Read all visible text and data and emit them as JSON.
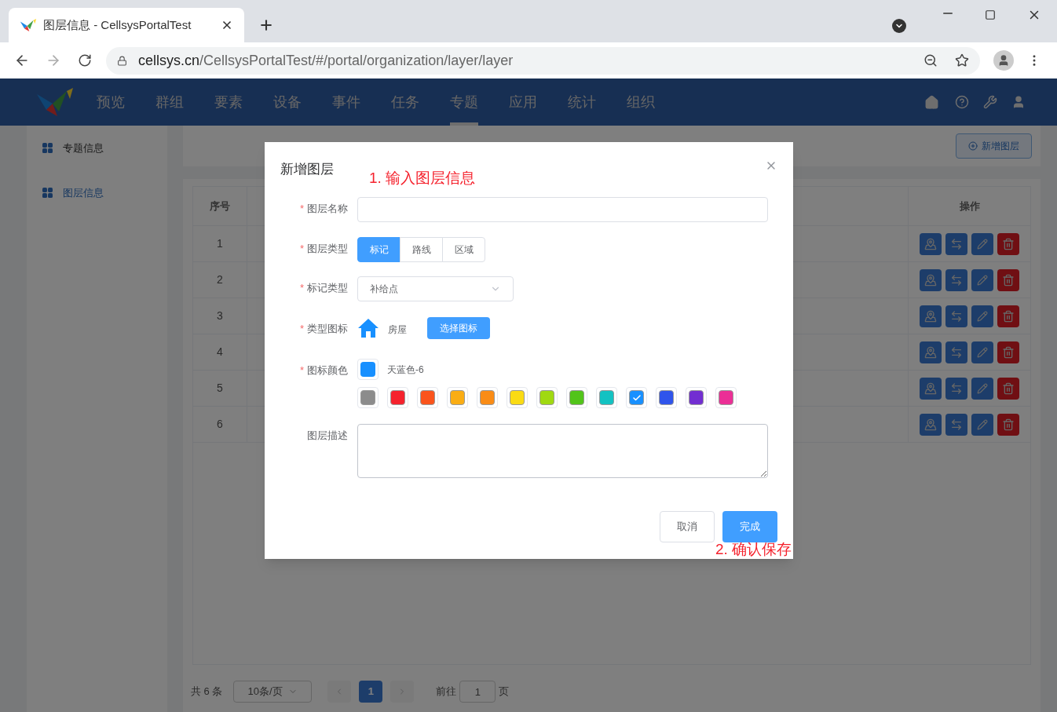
{
  "browser": {
    "tab_title": "图层信息 - CellsysPortalTest",
    "url_host": "cellsys.cn",
    "url_path": "/CellsysPortalTest/#/portal/organization/layer/layer"
  },
  "nav": {
    "items": [
      {
        "label": "预览",
        "selected": false
      },
      {
        "label": "群组",
        "selected": false
      },
      {
        "label": "要素",
        "selected": false
      },
      {
        "label": "设备",
        "selected": false
      },
      {
        "label": "事件",
        "selected": false
      },
      {
        "label": "任务",
        "selected": false
      },
      {
        "label": "专题",
        "selected": true
      },
      {
        "label": "应用",
        "selected": false
      },
      {
        "label": "统计",
        "selected": false
      },
      {
        "label": "组织",
        "selected": false
      }
    ]
  },
  "sidebar": {
    "items": [
      {
        "label": "专题信息",
        "selected": false
      },
      {
        "label": "图层信息",
        "selected": true
      }
    ]
  },
  "toolbar": {
    "add_button": "新增图层"
  },
  "table": {
    "columns": [
      "序号",
      "操作"
    ],
    "rows": [
      {
        "index": "1"
      },
      {
        "index": "2"
      },
      {
        "index": "3"
      },
      {
        "index": "4"
      },
      {
        "index": "5"
      },
      {
        "index": "6"
      }
    ]
  },
  "pagination": {
    "total": "共 6 条",
    "page_size": "10条/页",
    "pages": [
      {
        "label": "1",
        "selected": true
      }
    ],
    "goto_prefix": "前往",
    "goto_value": "1",
    "goto_suffix": "页"
  },
  "dialog": {
    "title": "新增图层",
    "note_top": "1. 输入图层信息",
    "note_bottom": "2. 确认保存",
    "fields": [
      {
        "kind": "text",
        "label": "图层名称",
        "required_mark": "*"
      },
      {
        "kind": "segmented",
        "label": "图层类型",
        "required_mark": "*",
        "options": [
          {
            "label": "标记",
            "selected": true
          },
          {
            "label": "路线",
            "selected": false
          },
          {
            "label": "区域",
            "selected": false
          }
        ]
      },
      {
        "kind": "select",
        "label": "标记类型",
        "required_mark": "*",
        "value": "补给点"
      },
      {
        "kind": "icon",
        "label": "类型图标",
        "required_mark": "*",
        "icon_name": "房屋",
        "button": "选择图标"
      },
      {
        "kind": "color",
        "label": "图标颜色",
        "required_mark": "*",
        "current": {
          "color": "#1890ff",
          "name": "天蓝色-6"
        },
        "swatches": [
          {
            "color": "#8c8c8c",
            "selected": false
          },
          {
            "color": "#f5222d",
            "selected": false
          },
          {
            "color": "#fa541c",
            "selected": false
          },
          {
            "color": "#faad14",
            "selected": false
          },
          {
            "color": "#fa8c16",
            "selected": false
          },
          {
            "color": "#fadb14",
            "selected": false
          },
          {
            "color": "#a0d911",
            "selected": false
          },
          {
            "color": "#52c41a",
            "selected": false
          },
          {
            "color": "#13c2c2",
            "selected": false
          },
          {
            "color": "#1890ff",
            "selected": true
          },
          {
            "color": "#2f54eb",
            "selected": false
          },
          {
            "color": "#722ed1",
            "selected": false
          },
          {
            "color": "#eb2f96",
            "selected": false
          }
        ]
      },
      {
        "kind": "textarea",
        "label": "图层描述"
      }
    ],
    "buttons": {
      "cancel": "取消",
      "confirm": "完成"
    }
  }
}
